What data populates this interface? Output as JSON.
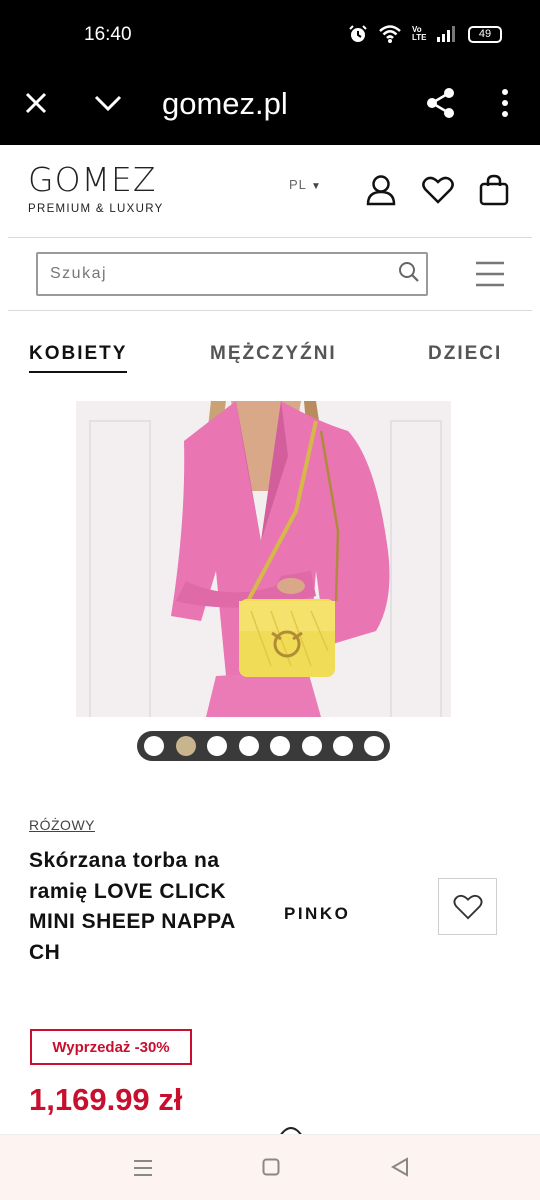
{
  "status_bar": {
    "time": "16:40",
    "battery": "49",
    "network": "Vo LTE",
    "icons": [
      "alarm-icon",
      "wifi-icon",
      "signal-icon",
      "battery-icon"
    ]
  },
  "browser": {
    "url": "gomez.pl",
    "icons": [
      "close-icon",
      "chevron-down-icon",
      "share-icon",
      "more-vert-icon"
    ]
  },
  "header": {
    "logo": "GOMEZ",
    "logo_tagline": "PREMIUM & LUXURY",
    "language": "PL",
    "icons": [
      "account-icon",
      "heart-icon",
      "bag-icon",
      "hamburger-icon"
    ]
  },
  "search": {
    "placeholder": "Szukaj"
  },
  "categories": {
    "tabs": [
      {
        "label": "KOBIETY",
        "active": true
      },
      {
        "label": "MĘŻCZYŹNI",
        "active": false
      },
      {
        "label": "DZIECI",
        "active": false
      }
    ]
  },
  "gallery": {
    "slide_count": 8,
    "active_slide": 2
  },
  "product": {
    "color": "RÓŻOWY",
    "title": "Skórzana torba na ramię LOVE CLICK MINI SHEEP NAPPA CH",
    "brand": "PINKO",
    "sale_badge": "Wyprzedaż -30%",
    "price": "1,169.99 zł"
  },
  "colors": {
    "accent_red": "#c8102e",
    "active_dot": "#c8b48d",
    "dark": "#111111"
  },
  "nav": {
    "icons": [
      "recents-icon",
      "home-icon",
      "back-icon"
    ]
  }
}
